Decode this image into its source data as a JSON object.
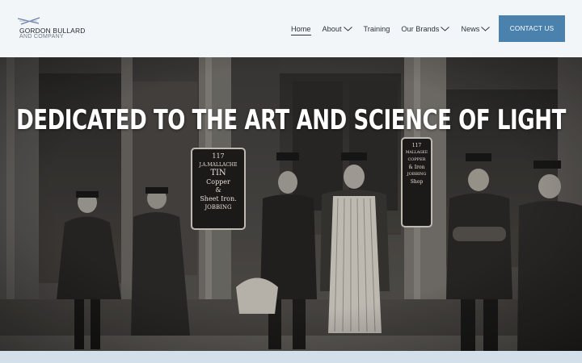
{
  "brand": {
    "line1": "GORDON BULLARD",
    "line2": "AND COMPANY"
  },
  "nav": {
    "items": [
      {
        "label": "Home",
        "active": true,
        "has_dropdown": false
      },
      {
        "label": "About",
        "active": false,
        "has_dropdown": true
      },
      {
        "label": "Training",
        "active": false,
        "has_dropdown": false
      },
      {
        "label": "Our Brands",
        "active": false,
        "has_dropdown": true
      },
      {
        "label": "News",
        "active": false,
        "has_dropdown": true
      }
    ],
    "cta_label": "CONTACT US"
  },
  "hero": {
    "title": "DEDICATED TO THE ART AND SCIENCE OF LIGHT",
    "sign_left": [
      "117",
      "J.A.MALLACHE",
      "TIN",
      "Copper",
      "&",
      "Sheet Iron.",
      "JOBBING"
    ],
    "sign_right": [
      "117",
      "MALLAGEE",
      "COPPER",
      "& Iron",
      "JOBBING",
      "Shop"
    ]
  },
  "colors": {
    "accent": "#4b82ad",
    "header_bg": "#f3f6f9",
    "band": "#d3dfe9"
  },
  "icons": {
    "logo_mark": "crossed-lines-logo",
    "dropdown": "chevron-down-icon"
  }
}
